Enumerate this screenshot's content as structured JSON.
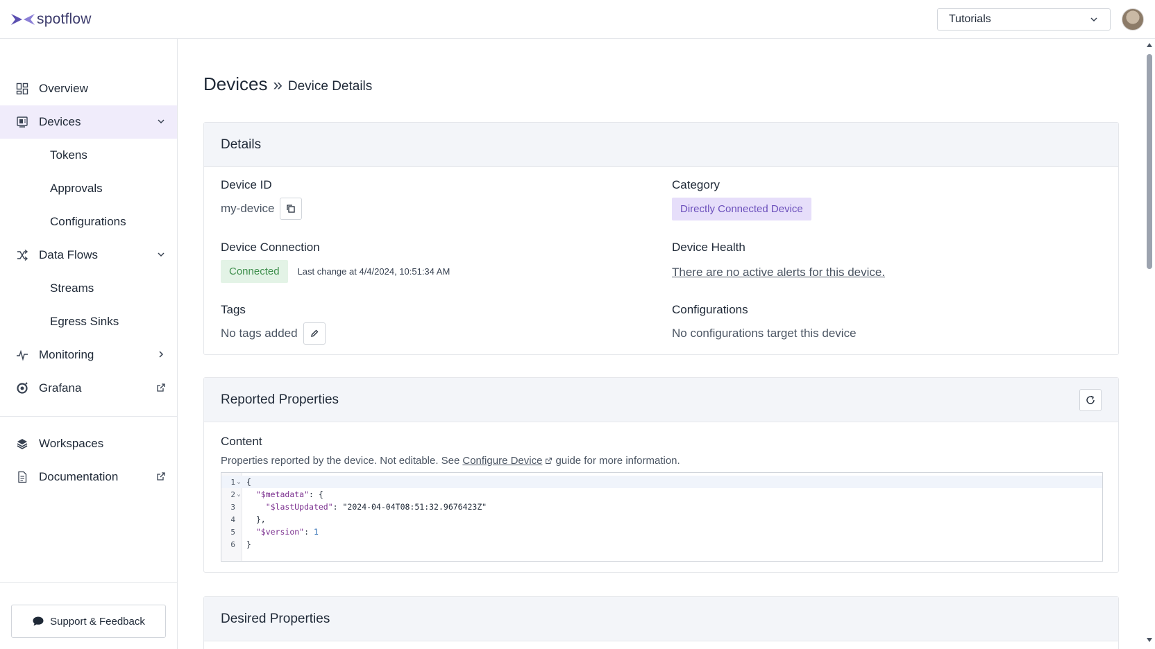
{
  "app": {
    "name": "spotflow"
  },
  "header": {
    "workspace_selected": "Tutorials"
  },
  "sidebar": {
    "items": [
      {
        "label": "Overview"
      },
      {
        "label": "Devices"
      },
      {
        "label": "Tokens"
      },
      {
        "label": "Approvals"
      },
      {
        "label": "Configurations"
      },
      {
        "label": "Data Flows"
      },
      {
        "label": "Streams"
      },
      {
        "label": "Egress Sinks"
      },
      {
        "label": "Monitoring"
      },
      {
        "label": "Grafana"
      },
      {
        "label": "Workspaces"
      },
      {
        "label": "Documentation"
      }
    ],
    "support_label": "Support & Feedback"
  },
  "breadcrumb": {
    "root": "Devices",
    "separator": "»",
    "current": "Device Details"
  },
  "details": {
    "title": "Details",
    "device_id_label": "Device ID",
    "device_id": "my-device",
    "category_label": "Category",
    "category": "Directly Connected Device",
    "connection_label": "Device Connection",
    "connection_status": "Connected",
    "last_change": "Last change at 4/4/2024, 10:51:34 AM",
    "health_label": "Device Health",
    "health_text": "There are no active alerts for this device.",
    "tags_label": "Tags",
    "tags_value": "No tags added",
    "configs_label": "Configurations",
    "configs_value": "No configurations target this device"
  },
  "reported": {
    "title": "Reported Properties",
    "content_label": "Content",
    "desc_before": "Properties reported by the device. Not editable. See",
    "desc_link": "Configure Device",
    "desc_after": "guide for more information.",
    "line_numbers": [
      "1",
      "2",
      "3",
      "4",
      "5",
      "6"
    ],
    "code": {
      "l1": "{",
      "l2_key": "\"$metadata\"",
      "l2_rest": ": {",
      "l3_key": "\"$lastUpdated\"",
      "l3_colon": ": ",
      "l3_val": "\"2024-04-04T08:51:32.9676423Z\"",
      "l4": "},",
      "l5_key": "\"$version\"",
      "l5_colon": ": ",
      "l5_val": "1",
      "l6": "}"
    }
  },
  "desired": {
    "title": "Desired Properties"
  }
}
